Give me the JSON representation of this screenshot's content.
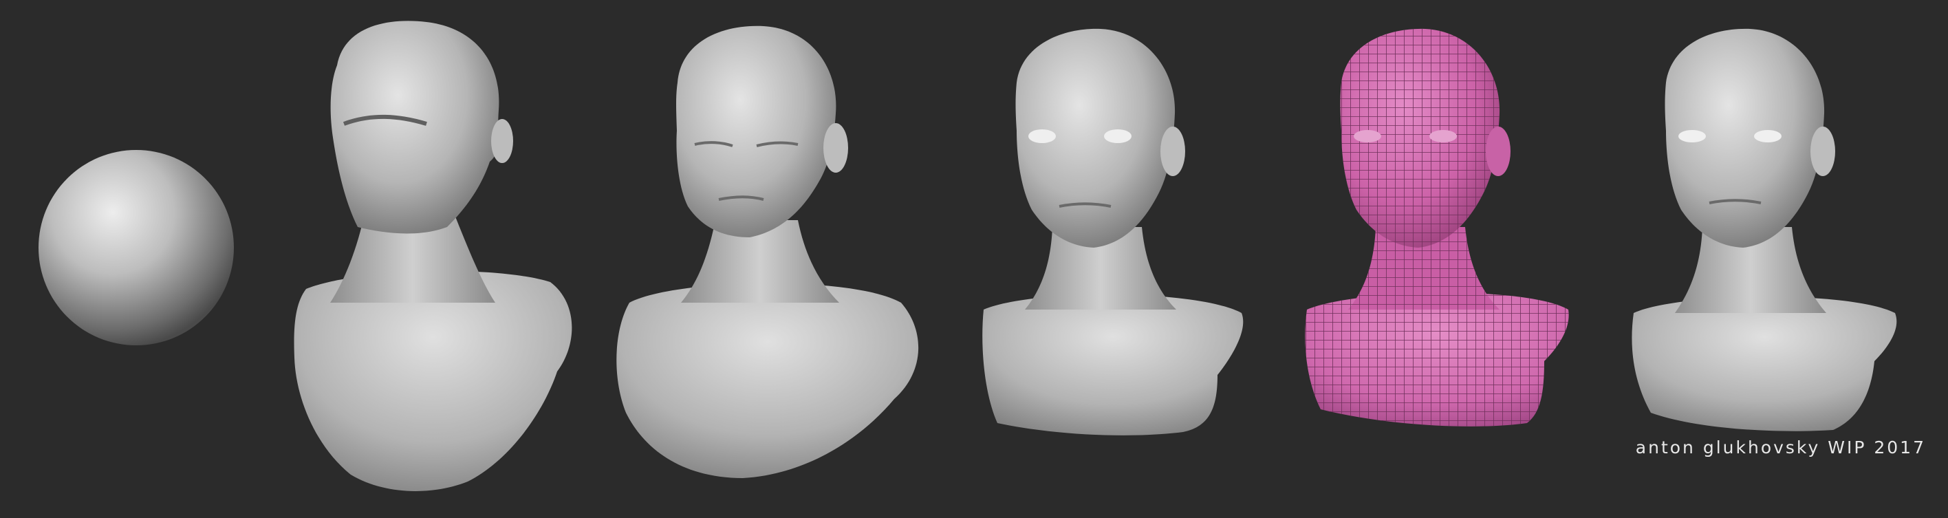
{
  "caption": "anton glukhovsky WIP 2017",
  "colors": {
    "background": "#2b2b2b",
    "clay_light": "#e2e2e2",
    "clay_mid": "#a9a9a9",
    "clay_dark": "#5a5a5a",
    "wireframe_fill": "#d46fb2",
    "wireframe_line": "#6e2f5a",
    "caption_text": "#e8e8e8"
  },
  "stages": [
    {
      "id": "sphere"
    },
    {
      "id": "blockout"
    },
    {
      "id": "refined"
    },
    {
      "id": "detailed"
    },
    {
      "id": "retopology"
    },
    {
      "id": "final"
    }
  ]
}
